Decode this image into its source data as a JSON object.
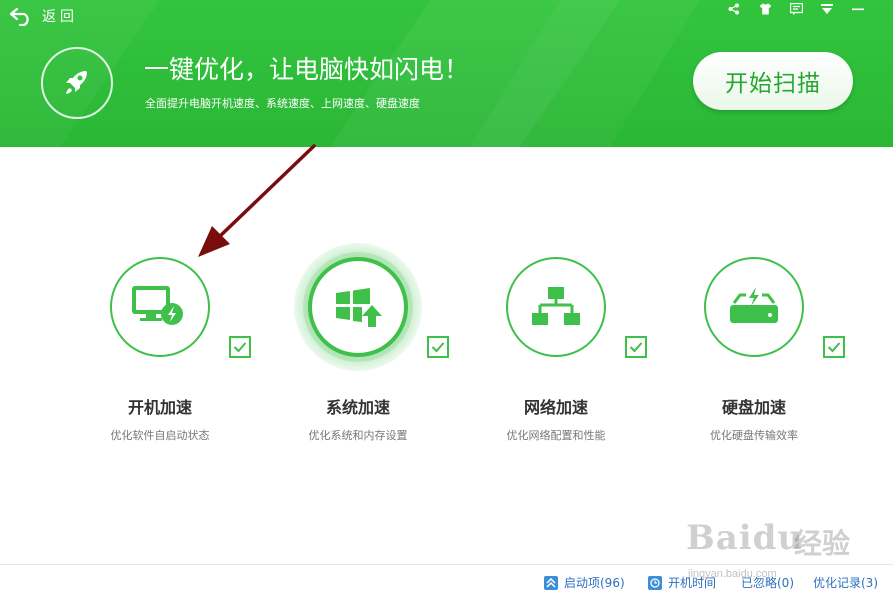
{
  "header": {
    "back_label": "返回",
    "headline": "一键优化，让电脑快如闪电！",
    "subline": "全面提升电脑开机速度、系统速度、上网速度、硬盘速度",
    "scan_button": "开始扫描",
    "accent": "#2ab736"
  },
  "window_controls": [
    "share-icon",
    "shirt-icon",
    "message-icon",
    "menu-icon",
    "minimize-icon"
  ],
  "cards": [
    {
      "title": "开机加速",
      "desc": "优化软件自启动状态",
      "icon": "monitor-bolt-icon",
      "checked": true
    },
    {
      "title": "系统加速",
      "desc": "优化系统和内存设置",
      "icon": "windows-up-icon",
      "checked": true
    },
    {
      "title": "网络加速",
      "desc": "优化网络配置和性能",
      "icon": "network-icon",
      "checked": true
    },
    {
      "title": "硬盘加速",
      "desc": "优化硬盘传输效率",
      "icon": "disk-bolt-icon",
      "checked": true
    }
  ],
  "footer": {
    "startup_items": "启动项(96)",
    "boot_time": "开机时间",
    "ignored": "已忽略(0)",
    "history": "优化记录(3)"
  },
  "watermark": {
    "brand": "Baidu",
    "cn": "经验",
    "url": "jingyan.baidu.com"
  }
}
